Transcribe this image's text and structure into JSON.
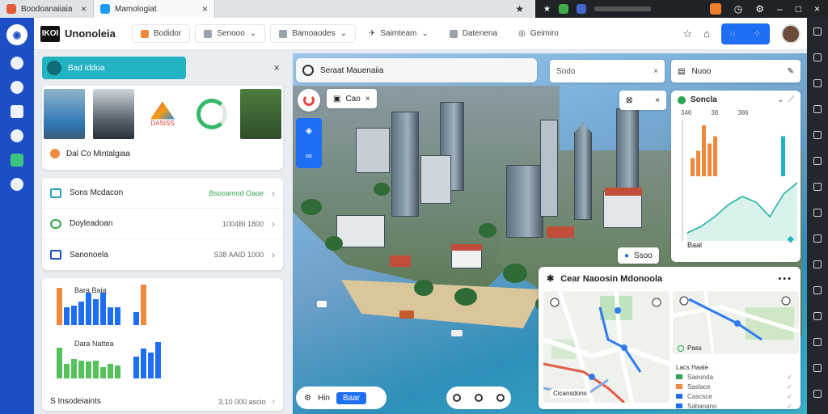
{
  "browser": {
    "tabs": [
      {
        "title": "Boodoanaiiaia",
        "active": false
      },
      {
        "title": "Mamologiat",
        "active": true
      }
    ]
  },
  "header": {
    "brand_box": "IKOI",
    "brand_name": "Unonoleia",
    "nav": [
      {
        "label": "Bodidor"
      },
      {
        "label": "Senooo"
      },
      {
        "label": "Bamoaodes"
      },
      {
        "label": "Saimteam"
      },
      {
        "label": "Datenena"
      },
      {
        "label": "Geimiro"
      }
    ]
  },
  "left": {
    "profile_label": "Bad Iddoa",
    "media_caption": "Dal Co Mintalgiaa",
    "media_logo_text": "DASISS",
    "list": [
      {
        "label": "Sons Mcdacon",
        "value": "Bsooamod Oaoe",
        "accent": "#2aa1b8",
        "value_color": "green"
      },
      {
        "label": "Doyleadoan",
        "value": "1004BI 1800",
        "accent": "#2ea44f",
        "value_color": "grey"
      },
      {
        "label": "Sanonoela",
        "value": "S38 AAID 1000",
        "accent": "#1d4fc4",
        "value_color": "grey"
      }
    ],
    "chart_titles": [
      "Bara Baia",
      "Dara Nattea"
    ],
    "footer_label": "S Insodeiaints",
    "footer_value": "3.10 000 ascio"
  },
  "map": {
    "search_label": "Seraat Mauenaiia",
    "search2_label": "Sodo",
    "chip1_label": "Cao",
    "chip2_label": "Ssoo",
    "bottom_left_label": "Hin",
    "bottom_left_tag": "Baar"
  },
  "right": {
    "top_label": "Nuoo",
    "panel_title": "Soncla",
    "panel_sub": [
      "346",
      "38",
      "386"
    ],
    "panel_foot": "Baal",
    "mapcard_title": "Cear Naoosin Mdonoola",
    "minimap_label_right": "Pass",
    "minimap_label_left": "Cicansdons",
    "legend_header": "Lacs Haale",
    "legend": [
      {
        "label": "Saeonda",
        "color": "#2ea44f"
      },
      {
        "label": "Saslace",
        "color": "#f0883e"
      },
      {
        "label": "Cascsce",
        "color": "#1d6ef2"
      },
      {
        "label": "Sabanano",
        "color": "#1d6ef2"
      }
    ]
  },
  "chart_data": [
    {
      "type": "bar",
      "title": "Bara Baia",
      "series": [
        {
          "values": [
            48,
            28,
            30,
            36,
            50,
            40,
            50,
            28,
            28
          ],
          "color": "#1d6ef2"
        },
        {
          "values": [
            58,
            20,
            62
          ],
          "color": "#f0883e"
        }
      ]
    },
    {
      "type": "bar",
      "title": "Dara Nattea",
      "series": [
        {
          "values": [
            48,
            22,
            30,
            28,
            26,
            28,
            18,
            22,
            20
          ],
          "color": "#56c15a"
        },
        {
          "values": [
            34,
            46,
            40,
            56
          ],
          "color": "#1d6ef2"
        }
      ]
    },
    {
      "type": "bar",
      "title": "Soncla",
      "series": [
        {
          "values": [
            25,
            35,
            70,
            45,
            55
          ],
          "color": "#f0883e"
        },
        {
          "values": [
            55
          ],
          "color": "#22b3c3"
        }
      ]
    },
    {
      "type": "line",
      "values": [
        10,
        18,
        30,
        45,
        55,
        48,
        30,
        58,
        72
      ],
      "color": "#22b3a3"
    }
  ]
}
